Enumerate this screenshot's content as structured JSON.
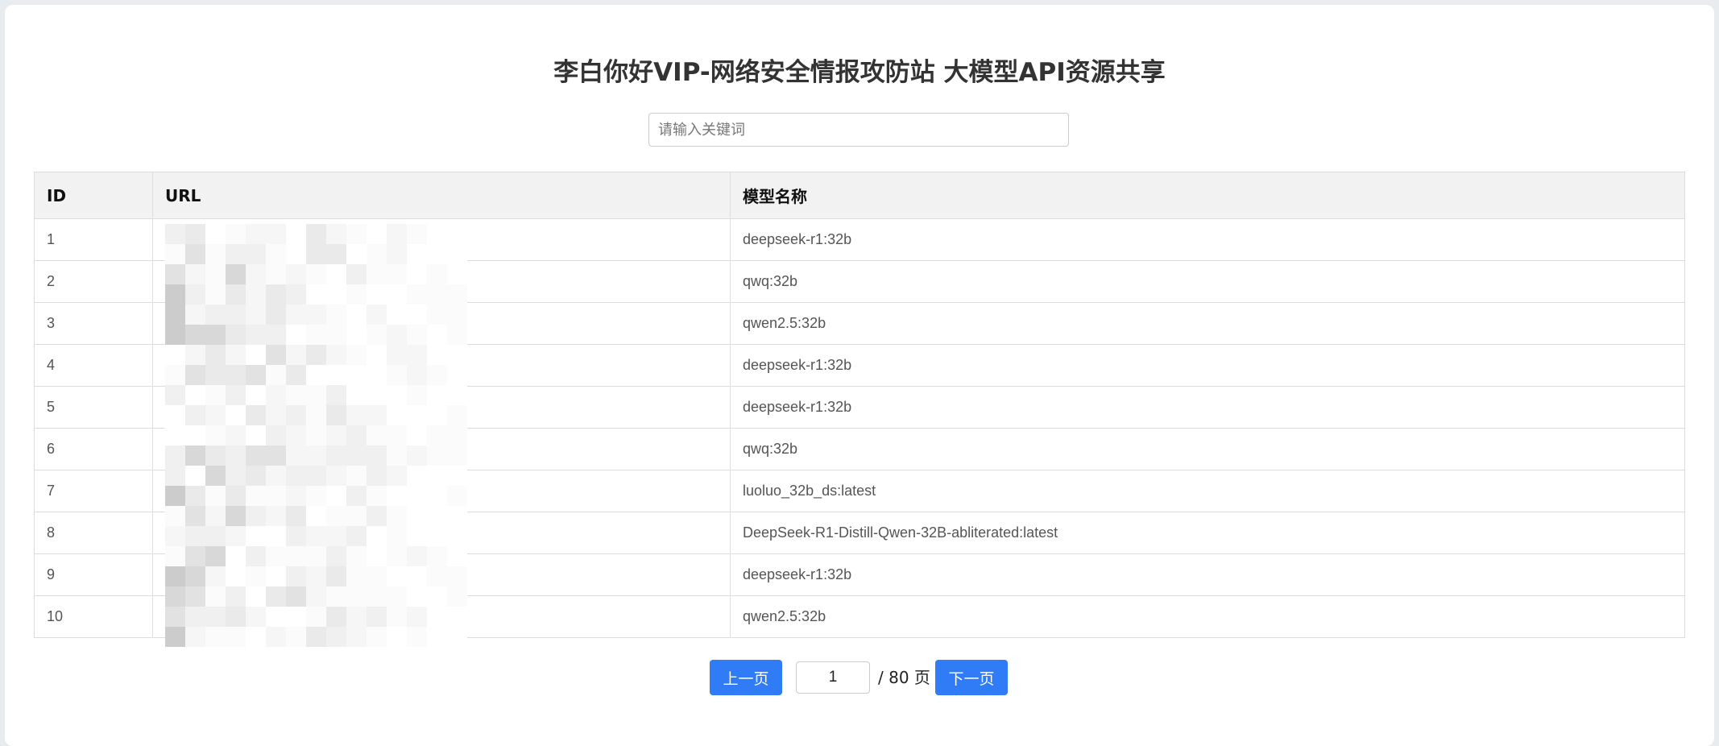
{
  "page": {
    "title": "李白你好VIP-网络安全情报攻防站 大模型API资源共享"
  },
  "search": {
    "placeholder": "请输入关键词",
    "value": ""
  },
  "table": {
    "headers": {
      "id": "ID",
      "url": "URL",
      "model": "模型名称"
    },
    "rows": [
      {
        "id": "1",
        "url": "http://",
        "model": "deepseek-r1:32b"
      },
      {
        "id": "2",
        "url": "http://",
        "model": "qwq:32b"
      },
      {
        "id": "3",
        "url": "http://",
        "model": "qwen2.5:32b"
      },
      {
        "id": "4",
        "url": "http://",
        "model": "deepseek-r1:32b"
      },
      {
        "id": "5",
        "url": "http://",
        "model": "deepseek-r1:32b"
      },
      {
        "id": "6",
        "url": "http://",
        "model": "qwq:32b"
      },
      {
        "id": "7",
        "url": "http://",
        "model": "luoluo_32b_ds:latest"
      },
      {
        "id": "8",
        "url": "http://",
        "model": "DeepSeek-R1-Distill-Qwen-32B-abliterated:latest"
      },
      {
        "id": "9",
        "url": "http://",
        "model": "deepseek-r1:32b"
      },
      {
        "id": "10",
        "url": "http://",
        "model": "qwen2.5:32b"
      }
    ]
  },
  "pagination": {
    "prev_label": "上一页",
    "next_label": "下一页",
    "current_page": "1",
    "total_text": "/ 80 页"
  },
  "colors": {
    "accent": "#2f7cf6",
    "header_bg": "#f2f2f2",
    "border": "#dddddd"
  }
}
